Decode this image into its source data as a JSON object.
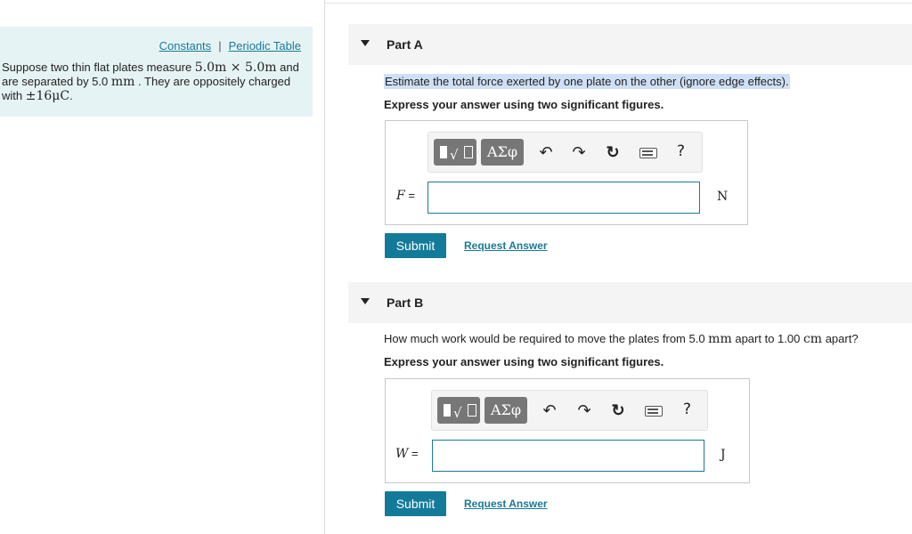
{
  "left": {
    "links": {
      "constants": "Constants",
      "separator": "|",
      "periodic_table": "Periodic Table"
    },
    "problem": {
      "t1": "Suppose two thin flat plates measure ",
      "m1": "5.0m × 5.0m",
      "t2": " and are separated by 5.0 ",
      "m2": "mm",
      "t3": " . They are oppositely charged with ",
      "m3": "±16μC",
      "t4": "."
    }
  },
  "toolbar": {
    "template_label": "√",
    "greek_label": "ΑΣφ",
    "undo": "↶",
    "redo": "↷",
    "reset": "↻",
    "help": "?"
  },
  "partA": {
    "title": "Part A",
    "question": "Estimate the total force exerted by one plate on the other (ignore edge effects).",
    "instruction": "Express your answer using two significant figures.",
    "var": "F",
    "eq": " =",
    "input_value": "",
    "unit": "N",
    "submit": "Submit",
    "request": "Request Answer"
  },
  "partB": {
    "title": "Part B",
    "q1": "How much work would be required to move the plates from 5.0 ",
    "qm1": "mm",
    "q2": " apart to 1.00 ",
    "qm2": "cm",
    "q3": " apart?",
    "instruction": "Express your answer using two significant figures.",
    "var": "W",
    "eq": " =",
    "input_value": "",
    "unit": "J",
    "submit": "Submit",
    "request": "Request Answer"
  }
}
